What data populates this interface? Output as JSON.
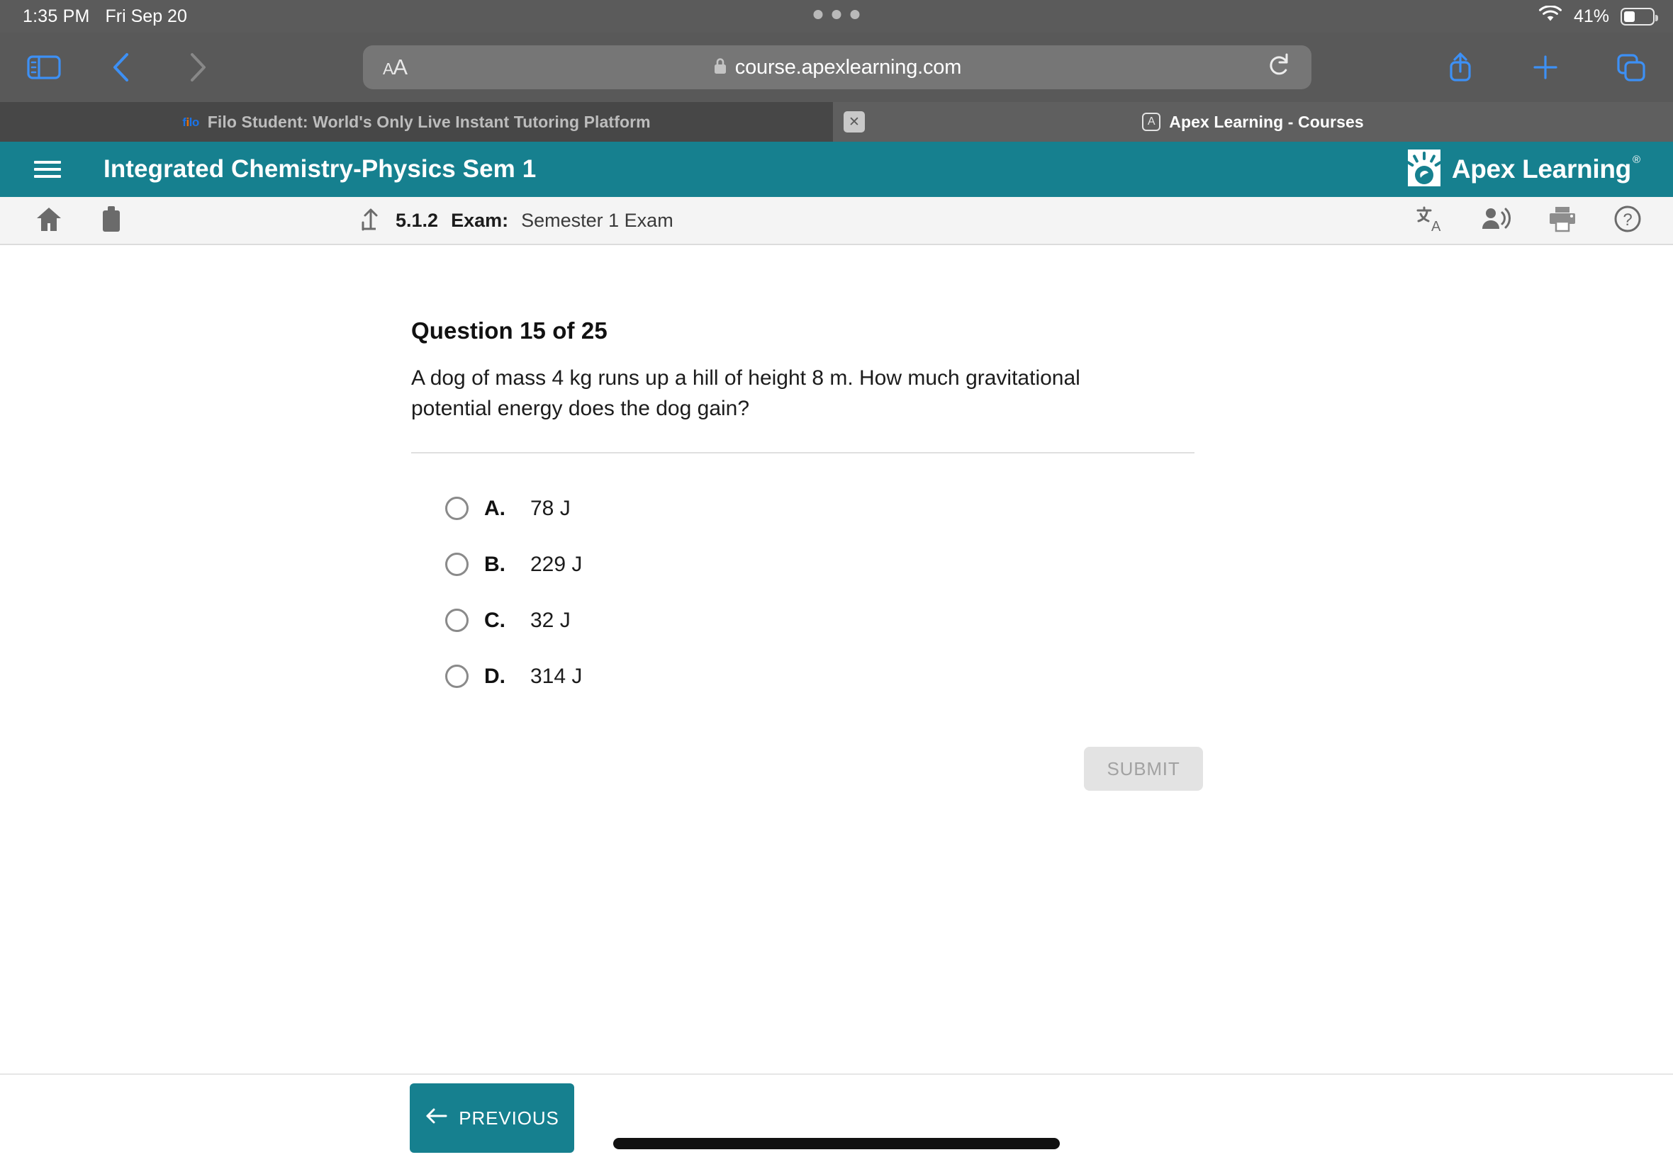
{
  "status_bar": {
    "time": "1:35 PM",
    "date": "Fri Sep 20",
    "battery_percent": "41%",
    "wifi_icon": "wifi-icon",
    "battery_icon": "battery-icon"
  },
  "browser": {
    "sidebar_icon": "sidebar-toggle-icon",
    "back_icon": "chevron-left-icon",
    "forward_icon": "chevron-right-icon",
    "text_size_label": "AA",
    "lock_icon": "lock-icon",
    "url": "course.apexlearning.com",
    "reload_icon": "reload-icon",
    "share_icon": "share-icon",
    "new_tab_icon": "plus-icon",
    "tabs_overview_icon": "tabs-icon",
    "tabs": [
      {
        "title": "Filo Student: World's Only Live Instant Tutoring Platform",
        "favicon": "filo-favicon",
        "favicon_text": "filo",
        "active": false
      },
      {
        "title": "Apex Learning - Courses",
        "favicon": "apex-favicon",
        "favicon_text": "A",
        "active": true
      }
    ],
    "close_tab_label": "✕"
  },
  "app_header": {
    "menu_icon": "hamburger-menu-icon",
    "course_title": "Integrated Chemistry-Physics Sem 1",
    "brand": "Apex Learning",
    "brand_registered": "®",
    "brand_logo_icon": "apex-lightbulb-logo",
    "accent_color": "#16808f"
  },
  "subnav": {
    "home_icon": "home-icon",
    "briefcase_icon": "briefcase-icon",
    "up_arrow_icon": "up-arrow-icon",
    "activity_number": "5.1.2",
    "activity_type": "Exam:",
    "activity_name": "Semester 1 Exam",
    "translate_icon": "translate-icon",
    "read_aloud_icon": "read-aloud-icon",
    "print_icon": "print-icon",
    "help_icon": "help-icon"
  },
  "question": {
    "heading": "Question 15 of 25",
    "number": 15,
    "total": 25,
    "text": "A dog of mass 4 kg runs up a hill of height 8 m. How much gravitational potential energy does the dog gain?",
    "options": [
      {
        "letter": "A.",
        "text": "78 J",
        "selected": false
      },
      {
        "letter": "B.",
        "text": "229 J",
        "selected": false
      },
      {
        "letter": "C.",
        "text": "32 J",
        "selected": false
      },
      {
        "letter": "D.",
        "text": "314 J",
        "selected": false
      }
    ],
    "submit_label": "SUBMIT",
    "submit_enabled": false
  },
  "footer": {
    "previous_label": "PREVIOUS",
    "previous_icon": "arrow-left-icon",
    "home_indicator": "home-indicator"
  }
}
